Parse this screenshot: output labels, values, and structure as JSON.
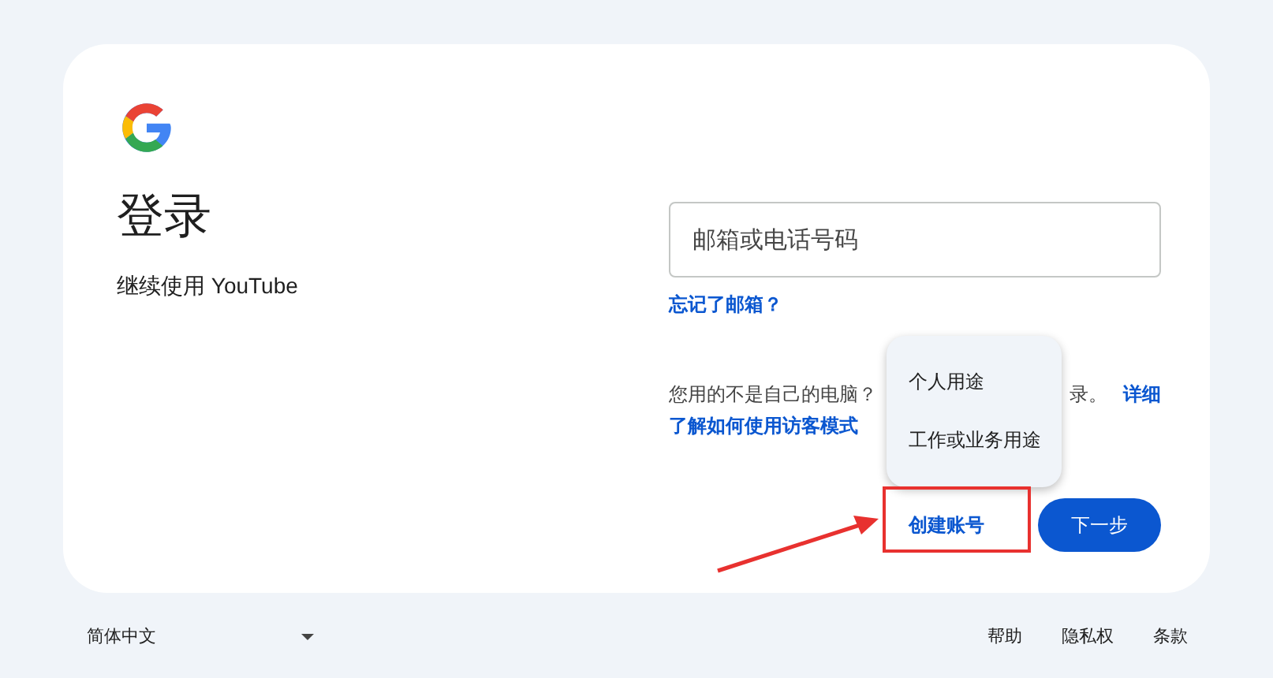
{
  "header": {
    "title": "登录",
    "subtitle": "继续使用 YouTube"
  },
  "email_field": {
    "placeholder": "邮箱或电话号码"
  },
  "forgot_link": "忘记了邮箱？",
  "guest_note": {
    "start": "您用的不是自己的电脑？",
    "end": "录。",
    "link_lines": [
      "详细",
      "了解如何使用访客模式"
    ]
  },
  "account_menu": {
    "items": [
      "个人用途",
      "工作或业务用途"
    ]
  },
  "actions": {
    "create_account": "创建账号",
    "next": "下一步"
  },
  "footer": {
    "language": "简体中文",
    "links": [
      "帮助",
      "隐私权",
      "条款"
    ]
  }
}
